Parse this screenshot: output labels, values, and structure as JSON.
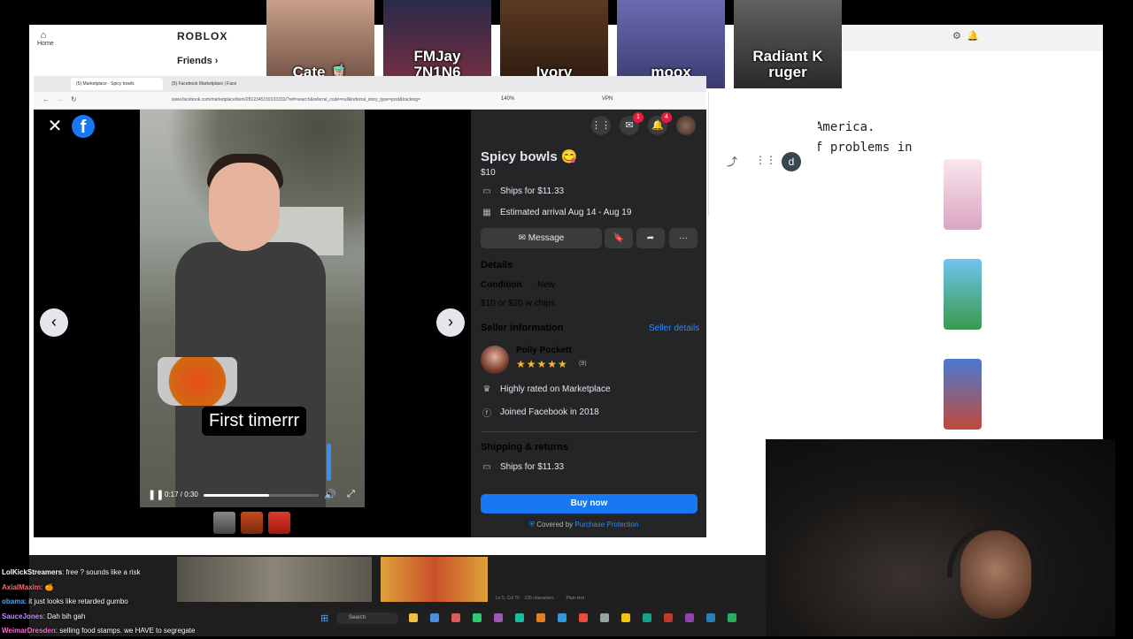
{
  "roblox": {
    "logo": "ROBLOX",
    "home_label": "Home",
    "friends_label": "Friends",
    "friends": [
      {
        "name": "Cate 🧋"
      },
      {
        "name": "FMJay\n7N1N6"
      },
      {
        "name": "Ivory"
      },
      {
        "name": "moox"
      },
      {
        "name": "Radiant K\nruger"
      }
    ]
  },
  "background_code": {
    "line1": "America.",
    "line2": "f problems in"
  },
  "background_avatar_letter": "d",
  "browser": {
    "tabs": [
      "(5) Marketplace - Spicy bowls",
      "(5) Facebook Marketplace | Face"
    ],
    "url": "www.facebook.com/marketplace/item/2812345159133333/?ref=search&referral_code=null&referral_story_type=post&tracking=",
    "zoom": "140%",
    "vpn_label": "VPN"
  },
  "fb": {
    "logo_letter": "f",
    "notifications": {
      "messenger": "1",
      "bell": "4"
    },
    "video": {
      "caption": "First timerrr",
      "time": "0:17 / 0:30",
      "progress": 0.57,
      "volume": 0.8
    },
    "listing": {
      "title": "Spicy bowls 😋",
      "price": "$10",
      "ships": "Ships for $11.33",
      "arrival": "Estimated arrival Aug 14 - Aug 19",
      "message_label": "Message",
      "details_heading": "Details",
      "condition_label": "Condition",
      "condition_value": "New",
      "description": "$10 or $20 w chips",
      "seller_heading": "Seller information",
      "seller_details_link": "Seller details",
      "seller_name": "Polly Pockett",
      "stars": "★★★★★",
      "rating_count": "(9)",
      "highly_rated": "Highly rated on Marketplace",
      "joined": "Joined Facebook in 2018",
      "shipping_heading": "Shipping & returns",
      "shipping_ships": "Ships for $11.33",
      "buy_label": "Buy now",
      "covered_prefix": "Covered by ",
      "protection_link": "Purchase Protection"
    }
  },
  "taskbar": {
    "search_placeholder": "Search",
    "status": "Ln 5, Col 70    235 characters          Plain text"
  },
  "chat": [
    {
      "user": "LolKickStreamers",
      "color": "#ffffff",
      "msg": ": free ? sounds like a risk"
    },
    {
      "user": "AxialMaxim",
      "color": "#ff6b6b",
      "msg": ": 🍊"
    },
    {
      "user": "obama",
      "color": "#4aa3ff",
      "msg": ": it just looks like retarded gumbo"
    },
    {
      "user": "SauceJones",
      "color": "#c58cff",
      "msg": ": Dah bih gah"
    },
    {
      "user": "WeimarDresden",
      "color": "#ff6ad5",
      "msg": ": selling food stamps. we HAVE to segregate"
    }
  ],
  "colors": {
    "fb_blue": "#1877f2",
    "panel_bg": "#242526",
    "link": "#2d88ff",
    "star": "#f7b928"
  }
}
